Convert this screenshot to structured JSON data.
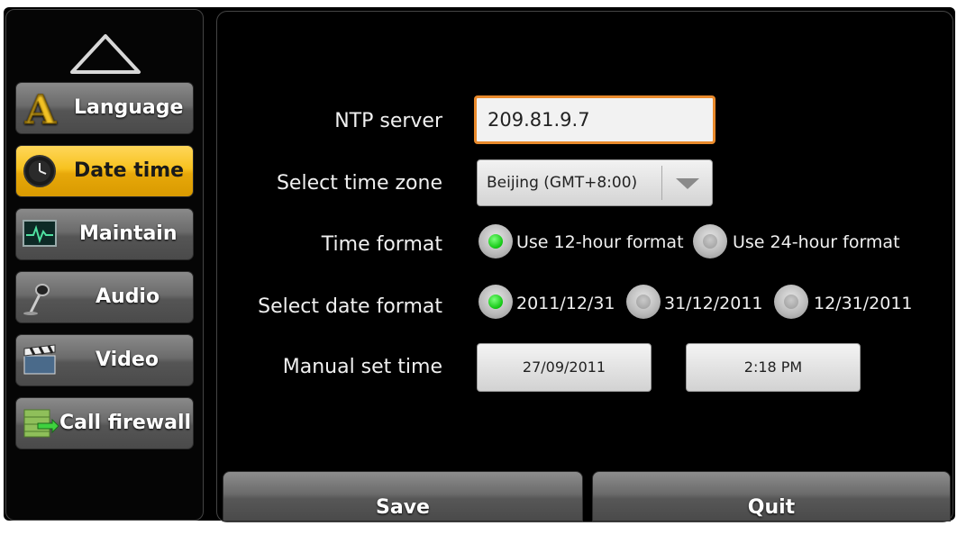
{
  "sidebar": {
    "items": [
      {
        "label": "Language",
        "icon": "letter-a-icon",
        "active": false
      },
      {
        "label": "Date time",
        "icon": "clock-icon",
        "active": true
      },
      {
        "label": "Maintain",
        "icon": "heartbeat-monitor-icon",
        "active": false
      },
      {
        "label": "Audio",
        "icon": "microphone-icon",
        "active": false
      },
      {
        "label": "Video",
        "icon": "clapperboard-icon",
        "active": false
      },
      {
        "label": "Call firewall",
        "icon": "firewall-icon",
        "active": false
      }
    ],
    "scroll_up_icon": "up-triangle-icon"
  },
  "form": {
    "ntp_label": "NTP server",
    "ntp_value": "209.81.9.7",
    "timezone_label": "Select time zone",
    "timezone_value": "Beijing (GMT+8:00)",
    "time_format_label": "Time format",
    "time_format_options": [
      "Use 12-hour format",
      "Use 24-hour format"
    ],
    "time_format_selected": "Use 12-hour format",
    "date_format_label": "Select date format",
    "date_format_options": [
      "2011/12/31",
      "31/12/2011",
      "12/31/2011"
    ],
    "date_format_selected": "2011/12/31",
    "manual_label": "Manual set time",
    "manual_date": "27/09/2011",
    "manual_time": "2:18 PM"
  },
  "buttons": {
    "save": "Save",
    "quit": "Quit"
  },
  "colors": {
    "active_item": "#f7c21f",
    "input_focus_border": "#e98a2c",
    "radio_selected": "#11c511",
    "background": "#000000"
  }
}
